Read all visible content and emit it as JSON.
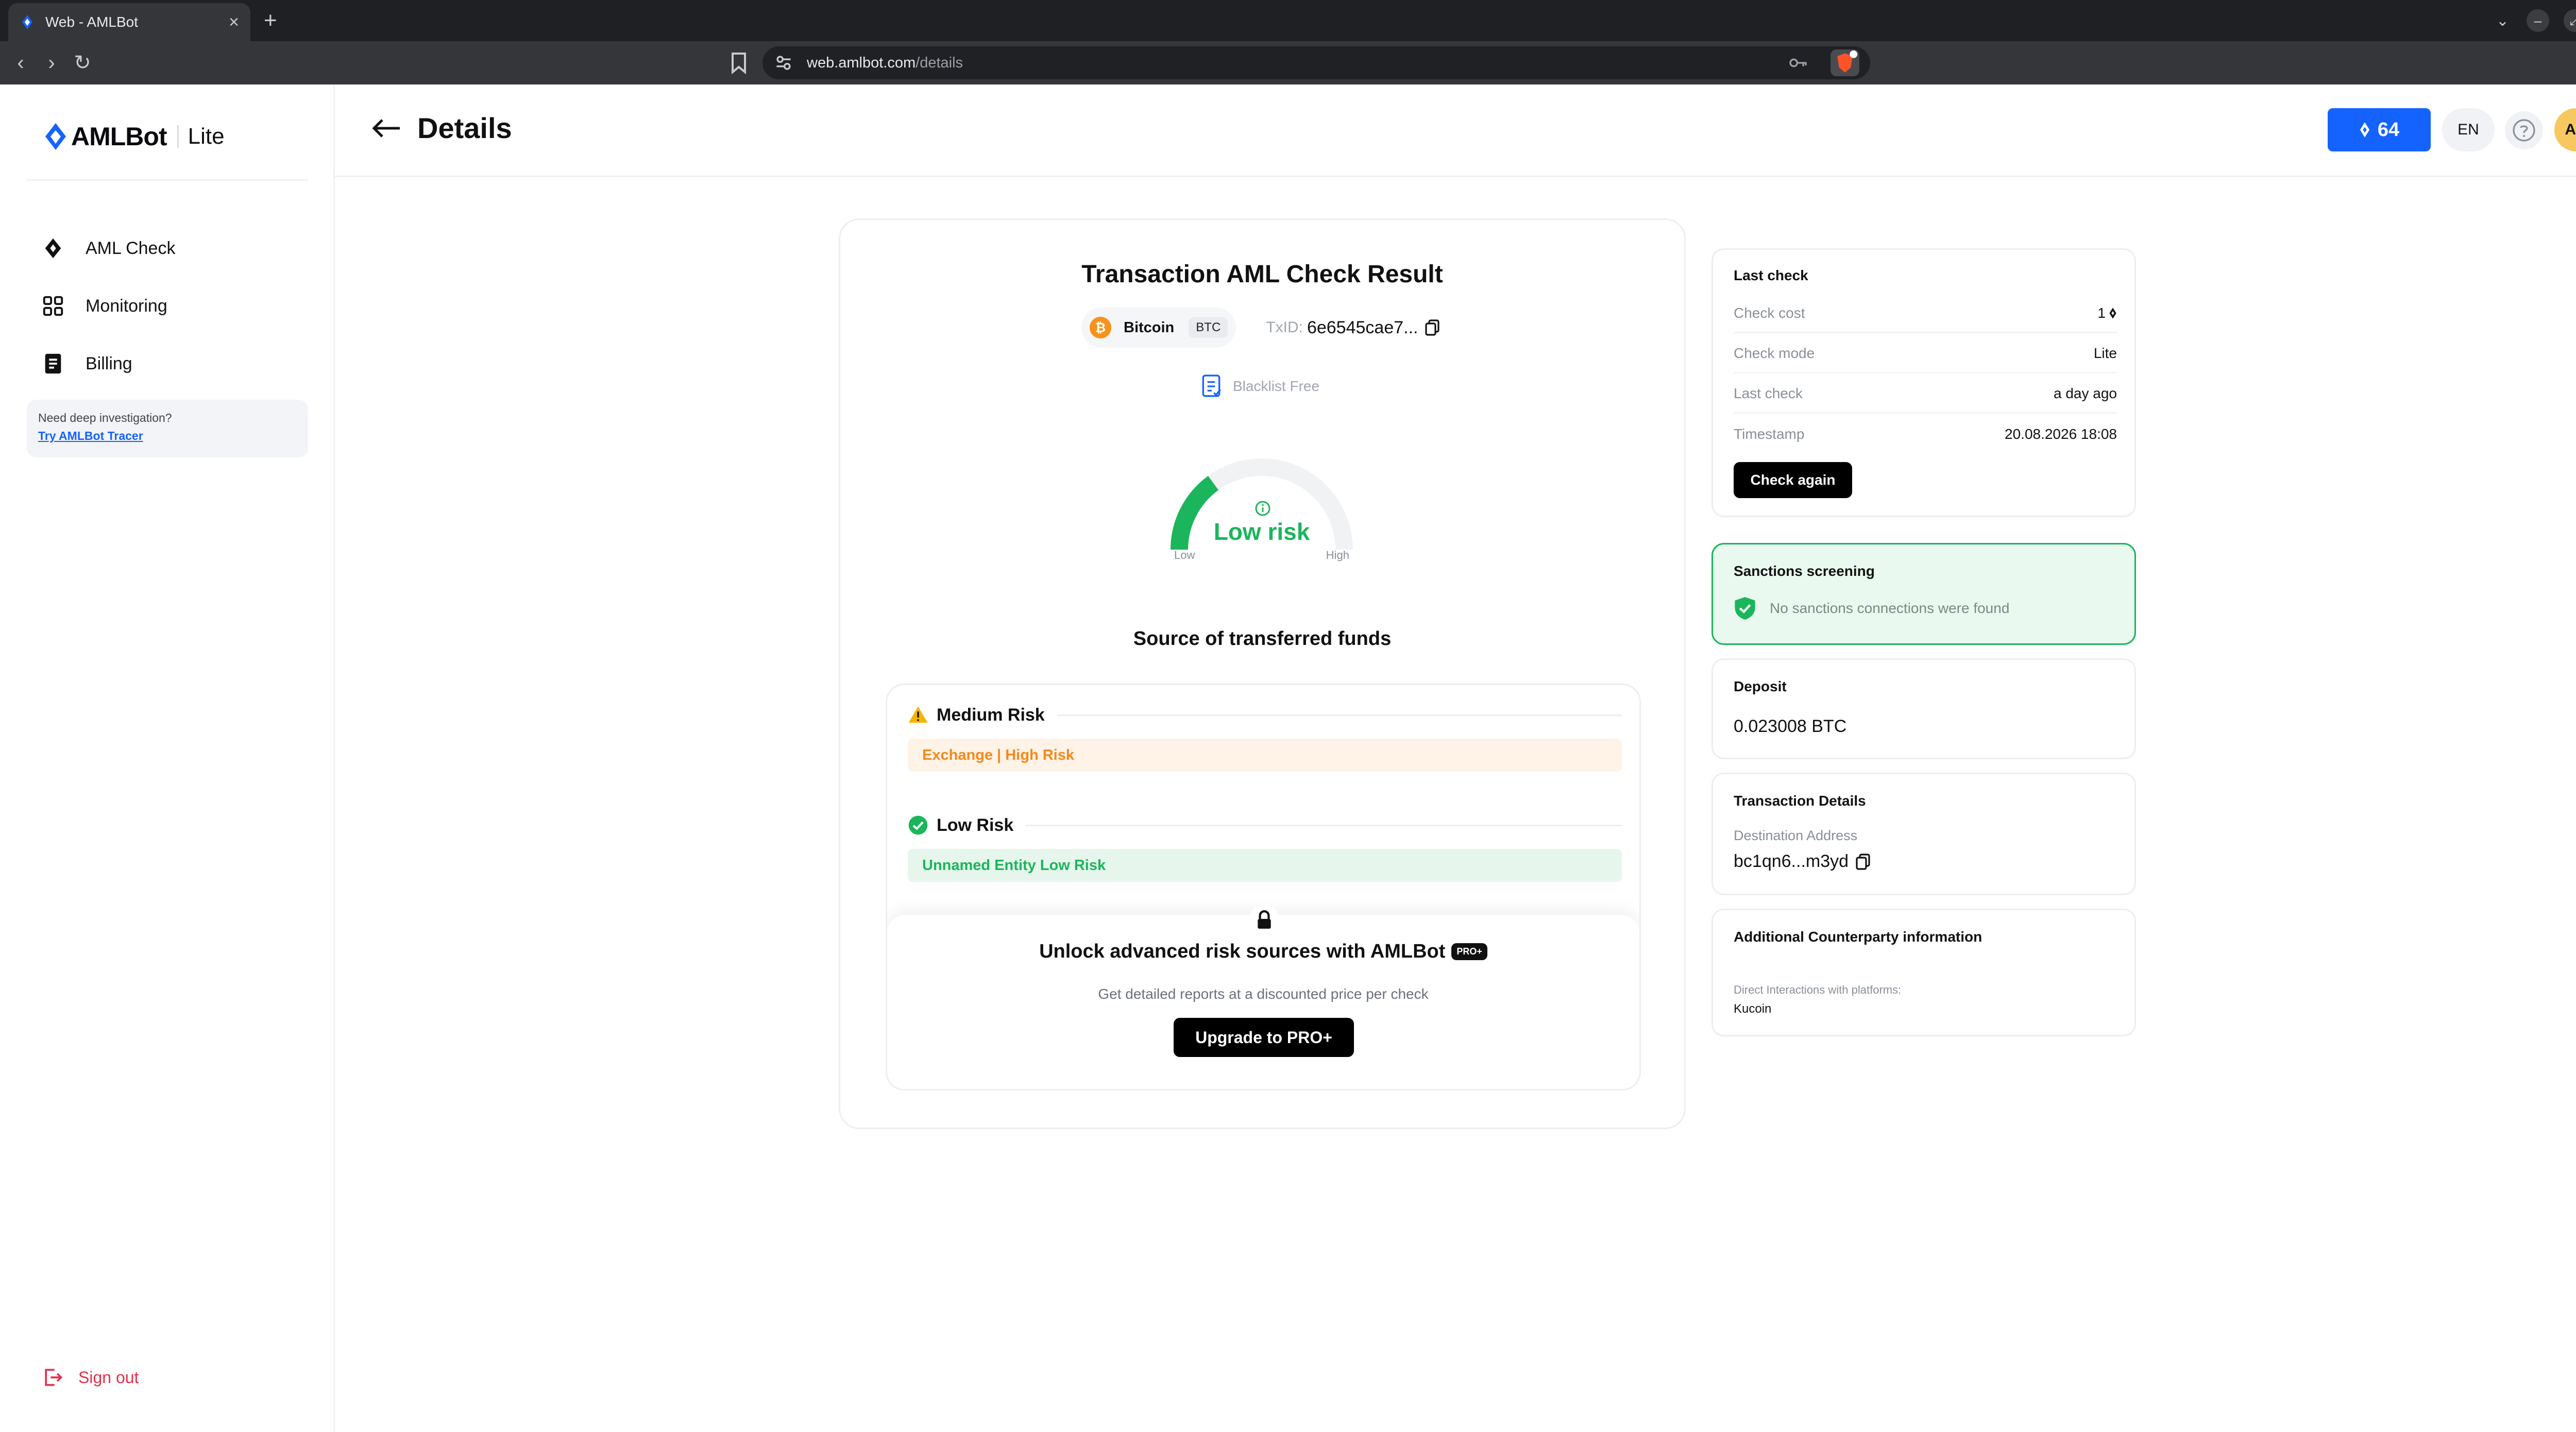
{
  "browser": {
    "tab_title": "Web - AMLBot",
    "url_host": "web.amlbot.com",
    "url_path": "/details"
  },
  "sidebar": {
    "brand_name": "AMLBot",
    "brand_tier": "Lite",
    "items": [
      {
        "label": "AML Check",
        "icon": "diamond-drop-icon"
      },
      {
        "label": "Monitoring",
        "icon": "grid-icon"
      },
      {
        "label": "Billing",
        "icon": "document-icon"
      }
    ],
    "promo_text": "Need deep investigation?",
    "promo_link": "Try AMLBot Tracer",
    "sign_out": "Sign out"
  },
  "header": {
    "title": "Details",
    "balance": "64",
    "language": "EN",
    "avatar_initials": "AD"
  },
  "result": {
    "title": "Transaction AML Check Result",
    "coin_name": "Bitcoin",
    "coin_ticker": "BTC",
    "txid_label": "TxID:",
    "txid_value": "6e6545cae7...",
    "blacklist": "Blacklist Free",
    "risk_score": 0.3,
    "risk_label": "Low risk",
    "gauge_low": "Low",
    "gauge_high": "High",
    "sources_title": "Source of transferred funds",
    "groups": [
      {
        "name": "Medium Risk",
        "entry": "Exchange | High Risk"
      },
      {
        "name": "Low Risk",
        "entry": "Unnamed Entity Low Risk"
      }
    ],
    "unlock_title": "Unlock advanced risk sources with AMLBot",
    "unlock_badge": "PRO+",
    "unlock_sub": "Get detailed reports at a discounted price per check",
    "upgrade_label": "Upgrade to PRO+"
  },
  "last_check": {
    "title": "Last check",
    "rows": [
      {
        "key": "Check cost",
        "value": "1"
      },
      {
        "key": "Check mode",
        "value": "Lite"
      },
      {
        "key": "Last check",
        "value": "a day ago"
      },
      {
        "key": "Timestamp",
        "value": "20.08.2026 18:08"
      }
    ],
    "button": "Check again"
  },
  "sanctions": {
    "title": "Sanctions screening",
    "message": "No sanctions connections were found"
  },
  "deposit": {
    "title": "Deposit",
    "value": "0.023008 BTC"
  },
  "tx_details": {
    "title": "Transaction Details",
    "dest_label": "Destination Address",
    "dest_value": "bc1qn6...m3yd"
  },
  "counterparty": {
    "title": "Additional Counterparty information",
    "label": "Direct Interactions with platforms:",
    "value": "Kucoin"
  },
  "colors": {
    "accent": "#1463ff",
    "low_risk": "#1bb55c",
    "medium_risk": "#f28a1c",
    "danger": "#e5304a"
  }
}
